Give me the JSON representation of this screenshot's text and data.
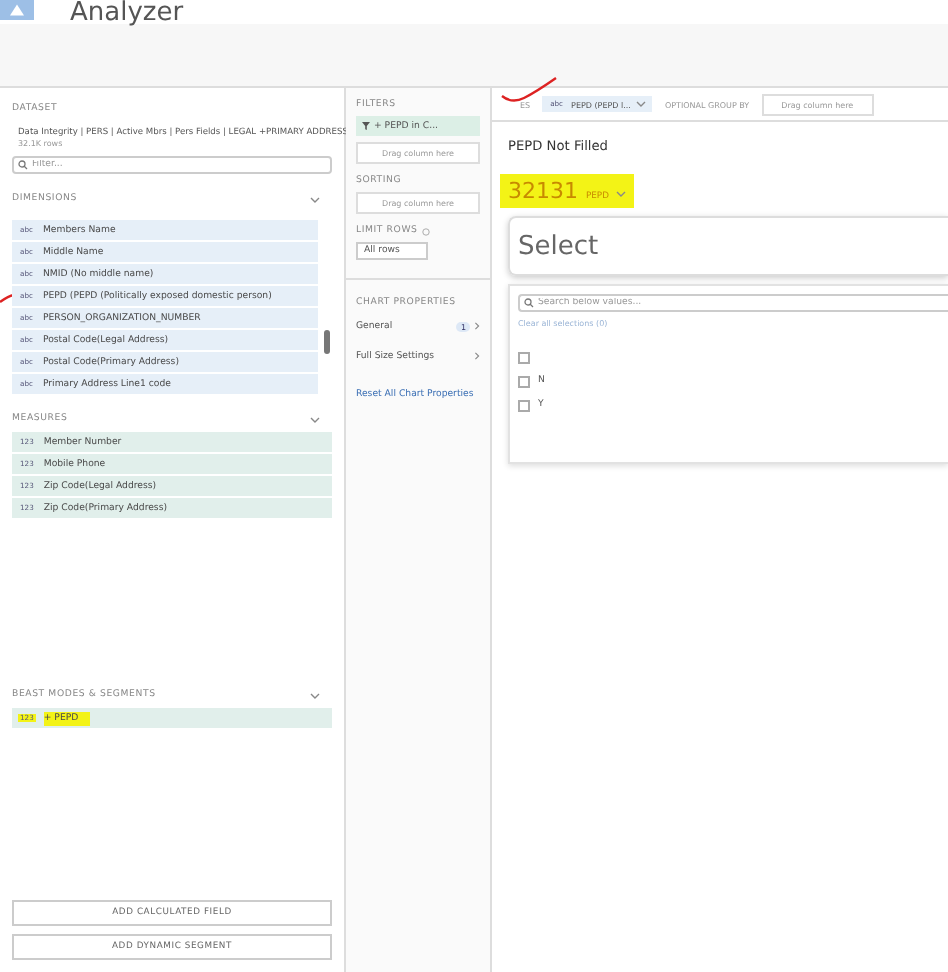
{
  "app": {
    "title": "Analyzer"
  },
  "dataset": {
    "heading": "DATASET",
    "name": "Data Integrity | PERS | Active Mbrs | Pers Fields | LEGAL +PRIMARY ADDRESS",
    "rows": "32.1K rows",
    "filter_placeholder": "Filter..."
  },
  "sections": [
    {
      "heading": "DIMENSIONS",
      "kind": "dimension",
      "scroll": true,
      "items": [
        {
          "label": "Members Name",
          "type_icon": "abc",
          "highlighted": false
        },
        {
          "label": "Middle Name",
          "type_icon": "abc",
          "highlighted": false
        },
        {
          "label": "NMID (No middle name)",
          "type_icon": "abc",
          "highlighted": false
        },
        {
          "label": "PEPD (PEPD (Politically exposed domestic person)",
          "type_icon": "abc",
          "highlighted": false
        },
        {
          "label": "PERSON_ORGANIZATION_NUMBER",
          "type_icon": "abc",
          "highlighted": false
        },
        {
          "label": "Postal Code(Legal Address)",
          "type_icon": "abc",
          "highlighted": false
        },
        {
          "label": "Postal Code(Primary Address)",
          "type_icon": "abc",
          "highlighted": false
        },
        {
          "label": "Primary Address Line1 code",
          "type_icon": "abc",
          "highlighted": false
        }
      ]
    },
    {
      "heading": "MEASURES",
      "kind": "measure",
      "items": [
        {
          "label": "Member Number",
          "type_icon": "123",
          "highlighted": false
        },
        {
          "label": "Mobile Phone",
          "type_icon": "123",
          "highlighted": false
        },
        {
          "label": "Zip Code(Legal Address)",
          "type_icon": "123",
          "highlighted": false
        },
        {
          "label": "Zip Code(Primary Address)",
          "type_icon": "123",
          "highlighted": false
        }
      ]
    },
    {
      "heading": "BEAST MODES & SEGMENTS",
      "kind": "measure",
      "items": [
        {
          "label": "+ PEPD",
          "type_icon": "123",
          "highlighted": true
        }
      ]
    }
  ],
  "actions": [
    "ADD CALCULATED FIELD",
    "ADD DYNAMIC SEGMENT"
  ],
  "middle": {
    "filters_heading": "FILTERS",
    "filter_chip": "+ PEPD in C...",
    "drop_hint_1": "Drag column here",
    "sorting_heading": "SORTING",
    "drop_hint_2": "Drag column here",
    "limit_heading": "LIMIT ROWS",
    "limit_value": "All rows",
    "chart_heading": "CHART PROPERTIES",
    "properties": [
      {
        "label": "General",
        "badge": "1"
      },
      {
        "label": "Full Size Settings"
      }
    ],
    "reset": "Reset All Chart Properties"
  },
  "chart_bar": {
    "values_label": "ES",
    "field_type": "abc",
    "field": "PEPD (PEPD l...",
    "group_label": "OPTIONAL GROUP BY",
    "group_hint": "Drag column here"
  },
  "card": {
    "title": "PEPD Not Filled",
    "value": "32131",
    "value_label": "PEPD",
    "highlighted": true,
    "select_label": "Select",
    "search_placeholder": "Search below values...",
    "clear": "Clear all selections (0)",
    "options": [
      {
        "checked": false
      },
      {
        "label": "N",
        "checked": false
      },
      {
        "label": "Y",
        "checked": false
      }
    ]
  }
}
